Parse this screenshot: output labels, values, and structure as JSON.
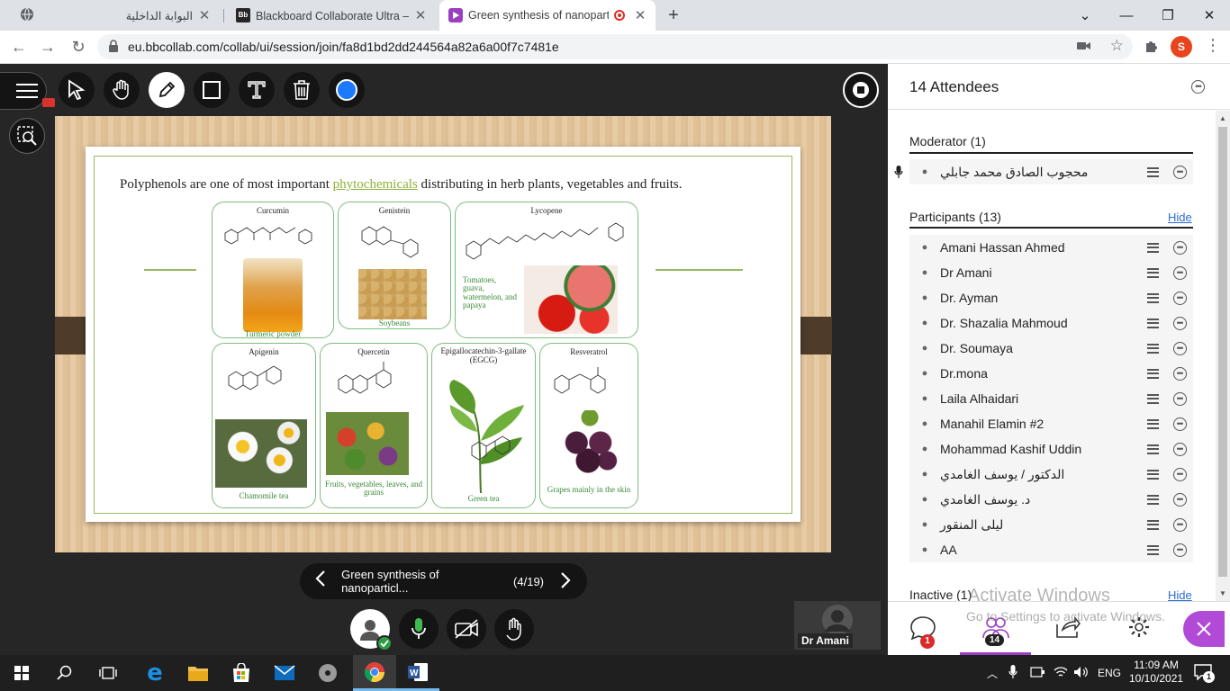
{
  "browser": {
    "tabs": [
      {
        "title": "البوابة الداخلية",
        "icon": "globe-icon",
        "active": false
      },
      {
        "title": "Blackboard Collaborate Ultra – قاعة",
        "icon": "blackboard-icon",
        "active": false
      },
      {
        "title": "Green synthesis of nanoparti",
        "icon": "collaborate-icon",
        "active": true
      }
    ],
    "new_tab": "+",
    "url": "eu.bbcollab.com/collab/ui/session/join/fa8d1bd2dd244564a82a6a00f7c7481e",
    "profile_initial": "S"
  },
  "slide": {
    "heading_before": "Polyphenols are one of most important ",
    "heading_link": "phytochemicals",
    "heading_after": " distributing in herb plants, vegetables and fruits.",
    "cards": {
      "curcumin": {
        "name": "Curcumin",
        "caption": "Turmeric powder"
      },
      "genistein": {
        "name": "Genistein",
        "caption": "Soybeans"
      },
      "lycopene": {
        "name": "Lycopene",
        "caption": "Tomatoes, guava, watermelon, and papaya"
      },
      "apigenin": {
        "name": "Apigenin",
        "caption": "Chamomile tea"
      },
      "quercetin": {
        "name": "Quercetin",
        "caption": "Fruits, vegetables, leaves, and grains"
      },
      "egcg": {
        "name": "Epigallocatechin-3-gallate (EGCG)",
        "caption": "Green tea"
      },
      "resveratrol": {
        "name": "Resveratrol",
        "caption": "Grapes mainly in the skin"
      }
    }
  },
  "pager": {
    "title": "Green synthesis of nanoparticl...",
    "position": "(4/19)"
  },
  "video_tile": {
    "name": "Dr Amani"
  },
  "panel": {
    "title": "14 Attendees",
    "moderator_heading": "Moderator (1)",
    "moderator": "محجوب الصادق محمد جابلي",
    "participants_heading": "Participants (13)",
    "hide_label": "Hide",
    "participants": [
      "Amani Hassan Ahmed",
      "Dr Amani",
      "Dr. Ayman",
      "Dr. Shazalia Mahmoud",
      "Dr. Soumaya",
      "Dr.mona",
      "Laila Alhaidari",
      "Manahil Elamin #2",
      "Mohammad Kashif Uddin",
      "الدكتور / يوسف الغامدي",
      "د. يوسف الغامدي",
      "ليلى المنقور",
      "AA"
    ],
    "inactive_heading": "Inactive (1)",
    "hide_label2": "Hide",
    "watermark_line1": "Activate Windows",
    "watermark_line2": "Go to Settings to activate Windows.",
    "chat_badge": "1",
    "attendees_badge": "14"
  },
  "taskbar": {
    "time": "11:09 AM",
    "date": "10/10/2021",
    "lang": "ENG",
    "notif_count": "1"
  },
  "colors": {
    "accent_purple": "#9b3fc2",
    "collab_blue": "#1d79ff",
    "link_blue": "#2b6cd4",
    "mic_green": "#3fb950"
  }
}
